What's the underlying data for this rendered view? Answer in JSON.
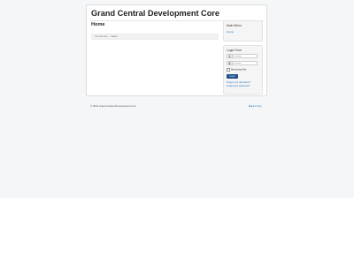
{
  "header": {
    "site_title": "Grand Central Development Core"
  },
  "main": {
    "page_title": "Home",
    "breadcrumb": {
      "prefix": "You are here:",
      "current": "Home"
    }
  },
  "sidebar": {
    "main_menu": {
      "title": "Main Menu",
      "items": [
        {
          "label": "Home"
        }
      ]
    },
    "login": {
      "title": "Login Form",
      "username_placeholder": "Username",
      "password_placeholder": "Password",
      "remember_label": "Remember Me",
      "login_label": "Log in",
      "forgot_username": "Forgot your username?",
      "forgot_password": "Forgot your password?"
    }
  },
  "footer": {
    "copyright": "© 2023 Grand Central Development Core",
    "back_to_top": "Back to Top"
  },
  "colors": {
    "link": "#1a6fb5",
    "button": "#1d4f8c",
    "page_band": "#f4f6f7"
  }
}
